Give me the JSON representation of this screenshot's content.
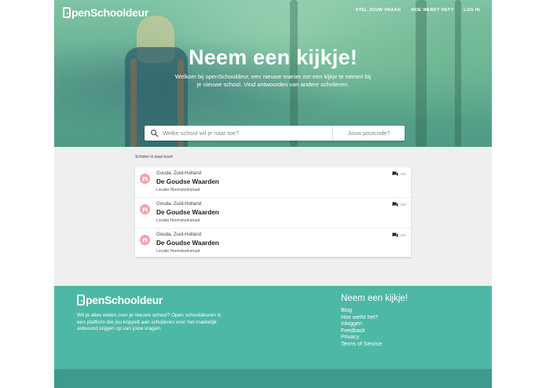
{
  "brand": {
    "name": "penSchooldeur"
  },
  "nav": {
    "items": [
      "STEL JOUW VRAAG",
      "HOE WERKT HET?",
      "LOG IN"
    ]
  },
  "hero": {
    "title": "Neem een kijkje!",
    "subtitle": "Welkom bij openSchooldeur, een nieuwe manier om een kijkje te nemen bij je nieuwe school. Vind antwoorden van andere scholieren.",
    "search_placeholder": "Welke school wil je naar toe?",
    "postcode_placeholder": "Jouw postcode?"
  },
  "schools": {
    "section_label": "Scholen in jouw buurt",
    "items": [
      {
        "location": "Gouda, Zuid-Holland",
        "name": "De Goudse Waarden",
        "street": "Locatie Heemskerkstraat",
        "count": "200"
      },
      {
        "location": "Gouda, Zuid-Holland",
        "name": "De Goudse Waarden",
        "street": "Locatie Heemskerkstraat",
        "count": "200"
      },
      {
        "location": "Gouda, Zuid-Holland",
        "name": "De Goudse Waarden",
        "street": "Locatie Heemskerkstraat",
        "count": "200"
      }
    ]
  },
  "footer": {
    "description": "Wil je alles weten over je nieuwe school? Open schooldeuren is een platform die jou koppelt aan scholieren voor het makkelijk antwoord krijgen op van jouw vragen.",
    "title": "Neem een kijkje!",
    "links": [
      "Blog",
      "Hoe werkt het?",
      "Inloggen",
      "Feedback",
      "Privacy",
      "Terms of Service"
    ]
  },
  "colors": {
    "teal": "#4db8a5",
    "teal_dark": "#3e9a8b",
    "badge_pink": "#f3a3a8",
    "page_bg": "#efefef"
  },
  "icons": {
    "search": "search-icon",
    "school": "school-icon",
    "comments": "chat-icon",
    "door": "door-logo-icon"
  }
}
